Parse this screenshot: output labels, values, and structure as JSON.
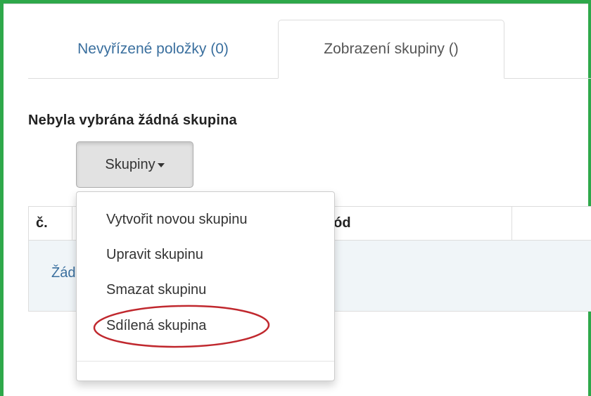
{
  "tabs": [
    {
      "label": "Nevyřízené položky (0)",
      "active": false
    },
    {
      "label": "Zobrazení skupiny ()",
      "active": true
    }
  ],
  "heading": "Nebyla vybrána žádná skupina",
  "groups_button": {
    "label": "Skupiny"
  },
  "dropdown": {
    "items": [
      {
        "label": "Vytvořit novou skupinu"
      },
      {
        "label": "Upravit skupinu"
      },
      {
        "label": "Smazat skupinu"
      },
      {
        "label": "Sdílená skupina",
        "highlighted": true
      }
    ]
  },
  "table": {
    "columns": [
      "č.",
      "kód",
      ""
    ],
    "empty_text": "Žád"
  },
  "colors": {
    "frame": "#2ea84a",
    "link": "#3a6f9e",
    "highlight_ellipse": "#c0282e",
    "empty_row_bg": "#f0f5f8"
  }
}
